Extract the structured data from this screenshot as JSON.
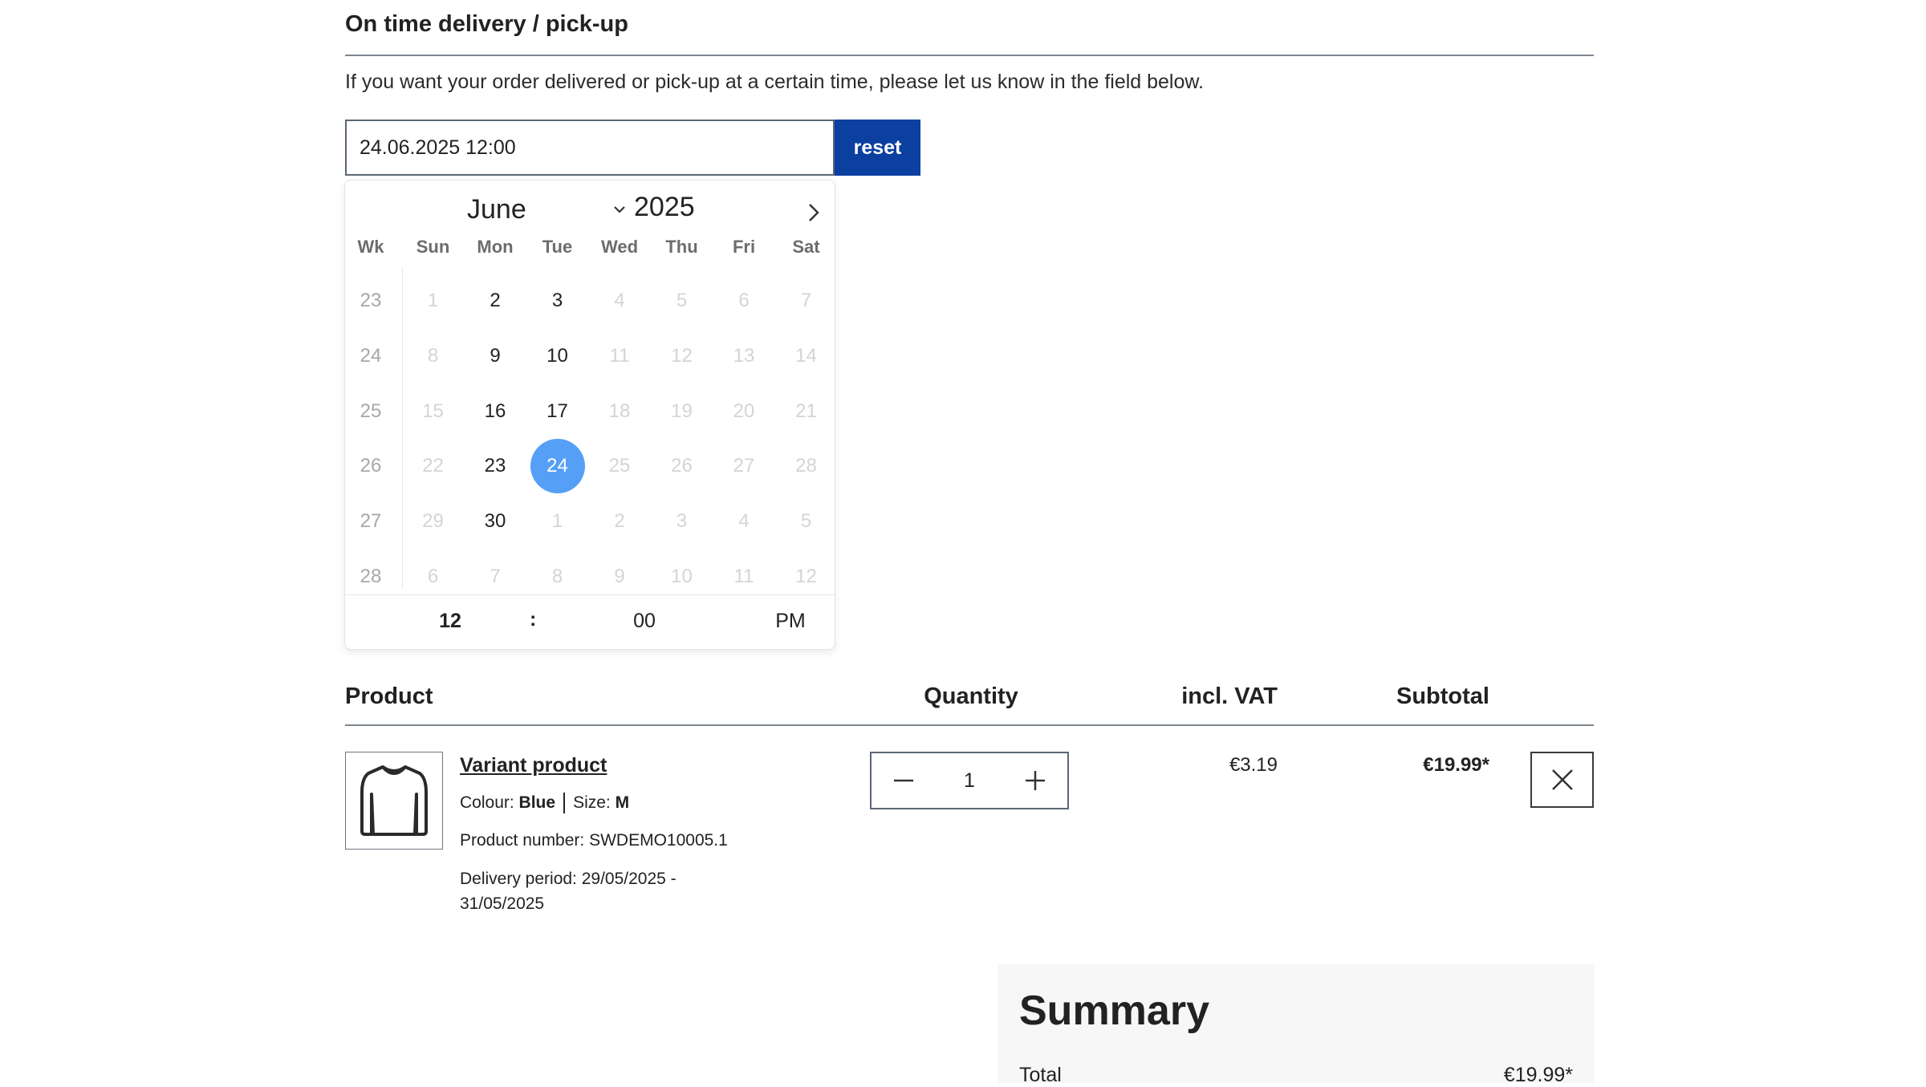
{
  "delivery": {
    "title": "On time delivery / pick-up",
    "description": "If you want your order delivered or pick-up at a certain time, please let us know in the field below.",
    "date_value": "24.06.2025 12:00",
    "reset_label": "reset"
  },
  "calendar": {
    "month": "June",
    "year": "2025",
    "weekday_headers": [
      "Wk",
      "Sun",
      "Mon",
      "Tue",
      "Wed",
      "Thu",
      "Fri",
      "Sat"
    ],
    "weeks": [
      {
        "wk": "23",
        "days": [
          {
            "d": "1",
            "s": "dis"
          },
          {
            "d": "2",
            "s": "cur"
          },
          {
            "d": "3",
            "s": "cur"
          },
          {
            "d": "4",
            "s": "dis"
          },
          {
            "d": "5",
            "s": "dis"
          },
          {
            "d": "6",
            "s": "dis"
          },
          {
            "d": "7",
            "s": "dis"
          }
        ]
      },
      {
        "wk": "24",
        "days": [
          {
            "d": "8",
            "s": "dis"
          },
          {
            "d": "9",
            "s": "cur"
          },
          {
            "d": "10",
            "s": "cur"
          },
          {
            "d": "11",
            "s": "dis"
          },
          {
            "d": "12",
            "s": "dis"
          },
          {
            "d": "13",
            "s": "dis"
          },
          {
            "d": "14",
            "s": "dis"
          }
        ]
      },
      {
        "wk": "25",
        "days": [
          {
            "d": "15",
            "s": "dis"
          },
          {
            "d": "16",
            "s": "cur"
          },
          {
            "d": "17",
            "s": "cur"
          },
          {
            "d": "18",
            "s": "dis"
          },
          {
            "d": "19",
            "s": "dis"
          },
          {
            "d": "20",
            "s": "dis"
          },
          {
            "d": "21",
            "s": "dis"
          }
        ]
      },
      {
        "wk": "26",
        "days": [
          {
            "d": "22",
            "s": "dis"
          },
          {
            "d": "23",
            "s": "cur"
          },
          {
            "d": "24",
            "s": "sel"
          },
          {
            "d": "25",
            "s": "dis"
          },
          {
            "d": "26",
            "s": "dis"
          },
          {
            "d": "27",
            "s": "dis"
          },
          {
            "d": "28",
            "s": "dis"
          }
        ]
      },
      {
        "wk": "27",
        "days": [
          {
            "d": "29",
            "s": "dis"
          },
          {
            "d": "30",
            "s": "cur"
          },
          {
            "d": "1",
            "s": "dis"
          },
          {
            "d": "2",
            "s": "dis"
          },
          {
            "d": "3",
            "s": "dis"
          },
          {
            "d": "4",
            "s": "dis"
          },
          {
            "d": "5",
            "s": "dis"
          }
        ]
      },
      {
        "wk": "28",
        "days": [
          {
            "d": "6",
            "s": "dis"
          },
          {
            "d": "7",
            "s": "dis"
          },
          {
            "d": "8",
            "s": "dis"
          },
          {
            "d": "9",
            "s": "dis"
          },
          {
            "d": "10",
            "s": "dis"
          },
          {
            "d": "11",
            "s": "dis"
          },
          {
            "d": "12",
            "s": "dis"
          }
        ]
      }
    ],
    "time": {
      "hour": "12",
      "separator": ":",
      "minute": "00",
      "ampm": "PM"
    },
    "selected_color": "#569ff7"
  },
  "table": {
    "headers": {
      "product": "Product",
      "quantity": "Quantity",
      "vat": "incl. VAT",
      "subtotal": "Subtotal"
    },
    "item": {
      "name": "Variant product",
      "colour_label": "Colour:",
      "colour_value": "Blue",
      "size_label": "Size:",
      "size_value": "M",
      "product_number": "Product number: SWDEMO10005.1",
      "delivery_period": "Delivery period: 29/05/2025 - 31/05/2025",
      "quantity": "1",
      "vat": "€3.19",
      "subtotal": "€19.99*",
      "image_icon": "shirt-icon"
    }
  },
  "summary": {
    "title": "Summary",
    "total_label": "Total",
    "total_value": "€19.99*"
  },
  "colors": {
    "primary_button": "#0b3fa0",
    "rule": "#7d8590"
  }
}
